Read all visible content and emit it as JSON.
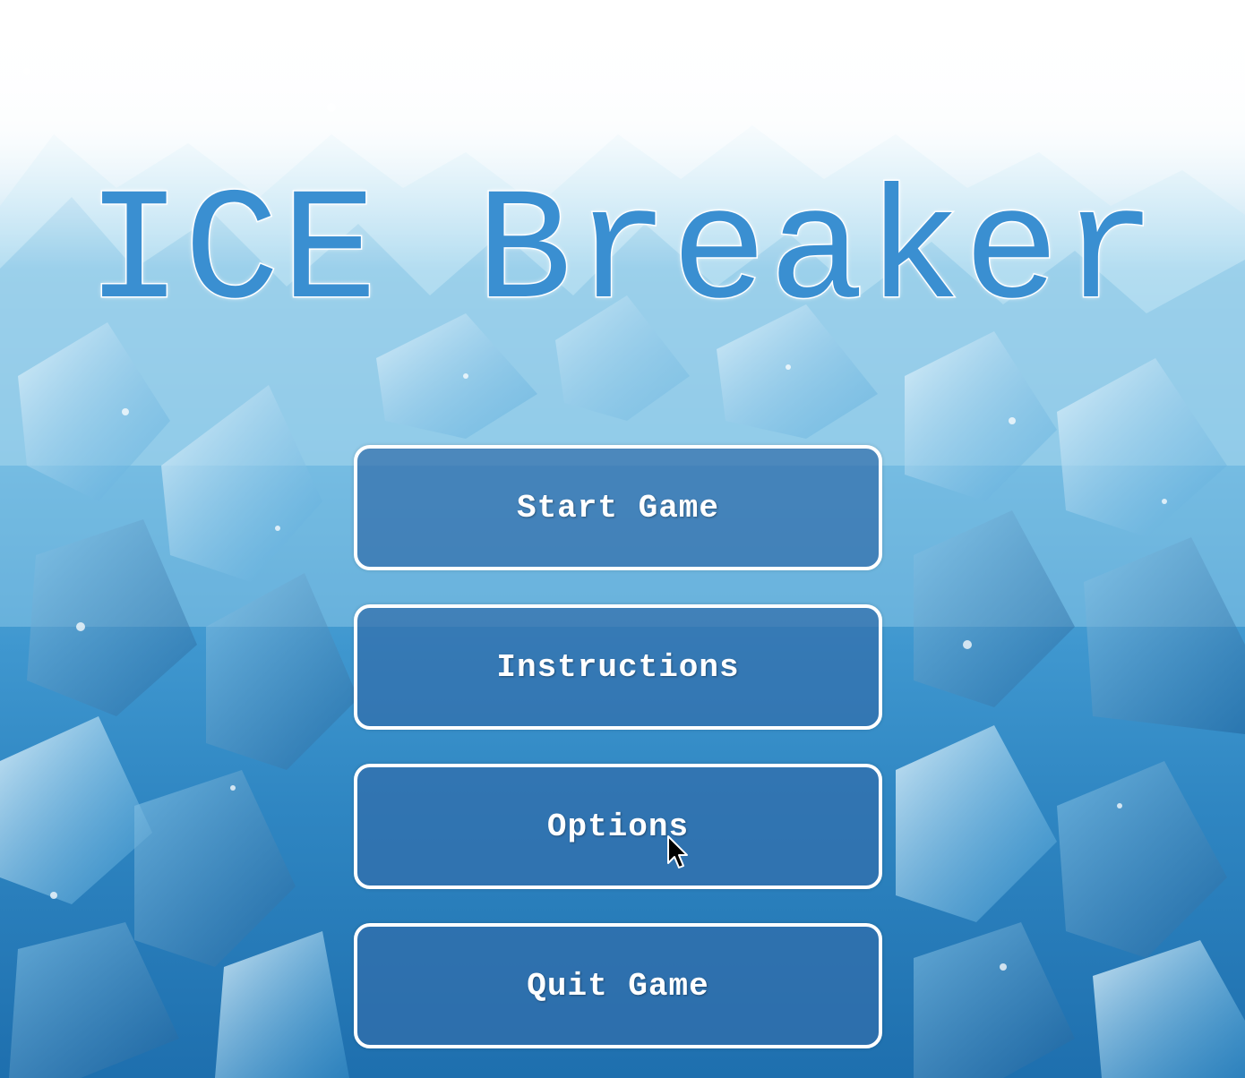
{
  "game": {
    "title": "ICE Breaker"
  },
  "menu": {
    "start_label": "Start Game",
    "instructions_label": "Instructions",
    "options_label": "Options",
    "quit_label": "Quit Game"
  },
  "icons": {
    "cursor": "mouse-pointer-icon",
    "background": "ice-crystals-background"
  },
  "colors": {
    "title": "#3a8fd1",
    "title_outline": "#ffffff",
    "button_fill": "#326eaa",
    "button_border": "#ffffff",
    "button_text": "#ffffff"
  }
}
